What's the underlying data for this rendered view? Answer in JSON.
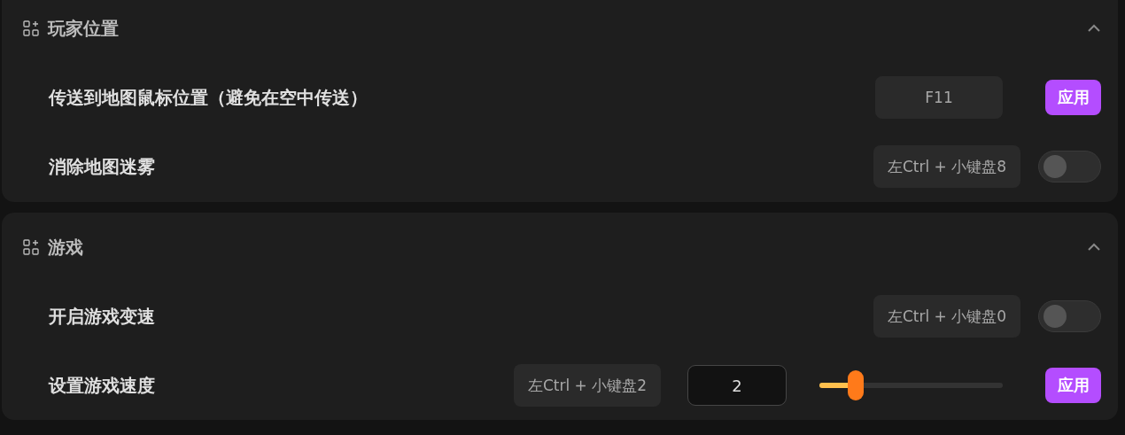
{
  "sections": [
    {
      "title": "玩家位置",
      "expanded": true,
      "rows": [
        {
          "label": "传送到地图鼠标位置（避免在空中传送）",
          "controls": [
            {
              "kind": "hotkey",
              "text": "F11"
            },
            {
              "kind": "button",
              "label": "应用"
            }
          ]
        },
        {
          "label": "消除地图迷雾",
          "controls": [
            {
              "kind": "hotkey",
              "text": "左Ctrl + 小键盘8"
            },
            {
              "kind": "toggle",
              "on": false
            }
          ]
        }
      ]
    },
    {
      "title": "游戏",
      "expanded": true,
      "rows": [
        {
          "label": "开启游戏变速",
          "controls": [
            {
              "kind": "hotkey",
              "text": "左Ctrl + 小键盘0"
            },
            {
              "kind": "toggle",
              "on": false
            }
          ]
        },
        {
          "label": "设置游戏速度",
          "controls": [
            {
              "kind": "hotkey",
              "text": "左Ctrl + 小键盘2"
            },
            {
              "kind": "input",
              "value": "2"
            },
            {
              "kind": "slider",
              "level": 0.2
            },
            {
              "kind": "button",
              "label": "应用"
            }
          ]
        }
      ]
    }
  ]
}
